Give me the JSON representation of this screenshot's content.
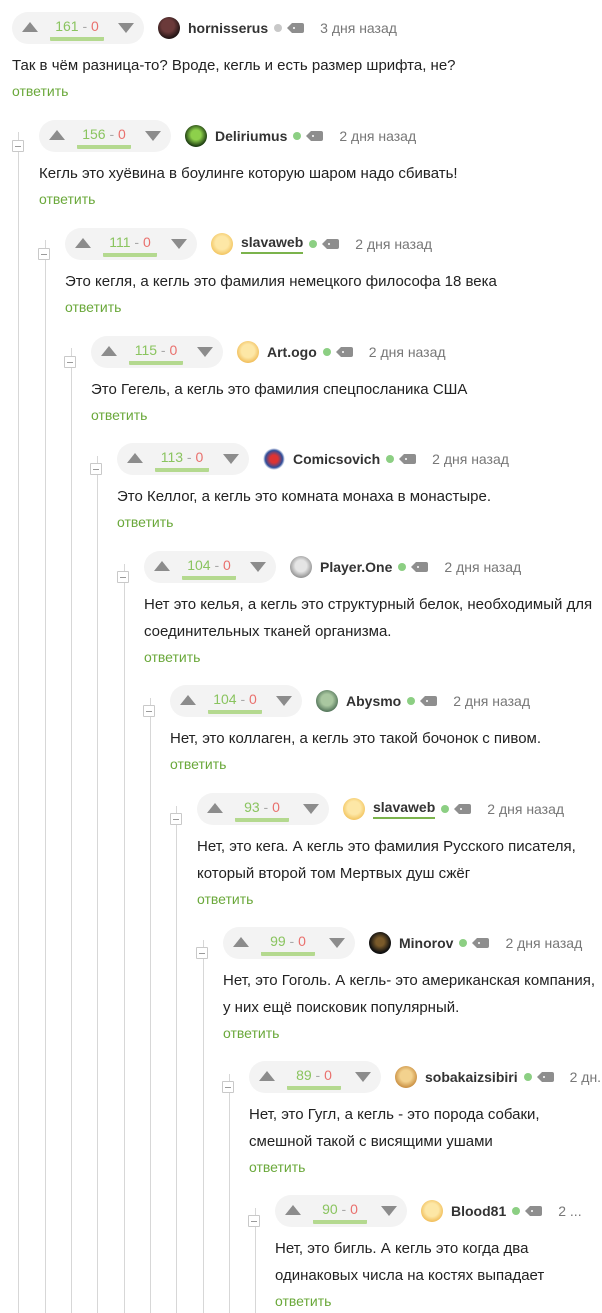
{
  "reply_label": "ответить",
  "colors": {
    "accent_green": "#6aa83a",
    "plus": "#8ac45f",
    "minus": "#e9706d",
    "online": "#8ccf83"
  },
  "comments": [
    {
      "score": {
        "plus": "161",
        "sep": "-",
        "minus": "0"
      },
      "author": "hornisserus",
      "online": false,
      "time": "3 дня назад",
      "text": "Так в чём разница-то? Вроде, кегль и есть размер шрифта, не?",
      "avatar_icon": "user-avatar-icon"
    },
    {
      "score": {
        "plus": "156",
        "sep": "-",
        "minus": "0"
      },
      "author": "Deliriumus",
      "online": true,
      "time": "2 дня назад",
      "text": "Кегль это хуёвина в боулинге которую шаром надо сбивать!",
      "avatar_icon": "user-avatar-icon"
    },
    {
      "score": {
        "plus": "111",
        "sep": "-",
        "minus": "0"
      },
      "author": "slavaweb",
      "online": true,
      "time": "2 дня назад",
      "text": "Это кегля, а кегль это фамилия немецкого философа 18 века",
      "avatar_icon": "user-avatar-icon"
    },
    {
      "score": {
        "plus": "115",
        "sep": "-",
        "minus": "0"
      },
      "author": "Art.ogo",
      "online": true,
      "time": "2 дня назад",
      "text": "Это Гегель, а кегль это фамилия спецпосланика США",
      "avatar_icon": "user-avatar-icon"
    },
    {
      "score": {
        "plus": "113",
        "sep": "-",
        "minus": "0"
      },
      "author": "Comicsovich",
      "online": true,
      "time": "2 дня назад",
      "text": "Это Келлог, а кегль это комната монаха в монастыре.",
      "avatar_icon": "user-avatar-icon"
    },
    {
      "score": {
        "plus": "104",
        "sep": "-",
        "minus": "0"
      },
      "author": "Player.One",
      "online": true,
      "time": "2 дня назад",
      "text": "Нет это келья, а кегль это структурный белок, необходимый для соединительных тканей организма.",
      "avatar_icon": "user-avatar-icon"
    },
    {
      "score": {
        "plus": "104",
        "sep": "-",
        "minus": "0"
      },
      "author": "Abysmo",
      "online": true,
      "time": "2 дня назад",
      "text": "Нет, это коллаген, а кегль это такой бочонок с пивом.",
      "avatar_icon": "user-avatar-icon"
    },
    {
      "score": {
        "plus": "93",
        "sep": "-",
        "minus": "0"
      },
      "author": "slavaweb",
      "online": true,
      "time": "2 дня назад",
      "text": "Нет, это кега. А кегль это фамилия Русского писателя, который второй том Мертвых душ сжёг",
      "avatar_icon": "user-avatar-icon"
    },
    {
      "score": {
        "plus": "99",
        "sep": "-",
        "minus": "0"
      },
      "author": "Minorov",
      "online": true,
      "time": "2 дня назад",
      "text": "Нет, это Гоголь. А кегль- это американская компания, у них ещё поисковик популярный.",
      "avatar_icon": "user-avatar-icon"
    },
    {
      "score": {
        "plus": "89",
        "sep": "-",
        "minus": "0"
      },
      "author": "sobakaizsibiri",
      "online": true,
      "time": "2 дн...",
      "text": "Нет, это Гугл, а кегль - это порода собаки, смешной такой с висящими ушами",
      "avatar_icon": "user-avatar-icon"
    },
    {
      "score": {
        "plus": "90",
        "sep": "-",
        "minus": "0"
      },
      "author": "Blood81",
      "online": true,
      "time": "2 ...",
      "text": "Нет, это бигль. А кегль это когда два одинаковых числа на костях выпадает",
      "avatar_icon": "user-avatar-icon"
    }
  ]
}
